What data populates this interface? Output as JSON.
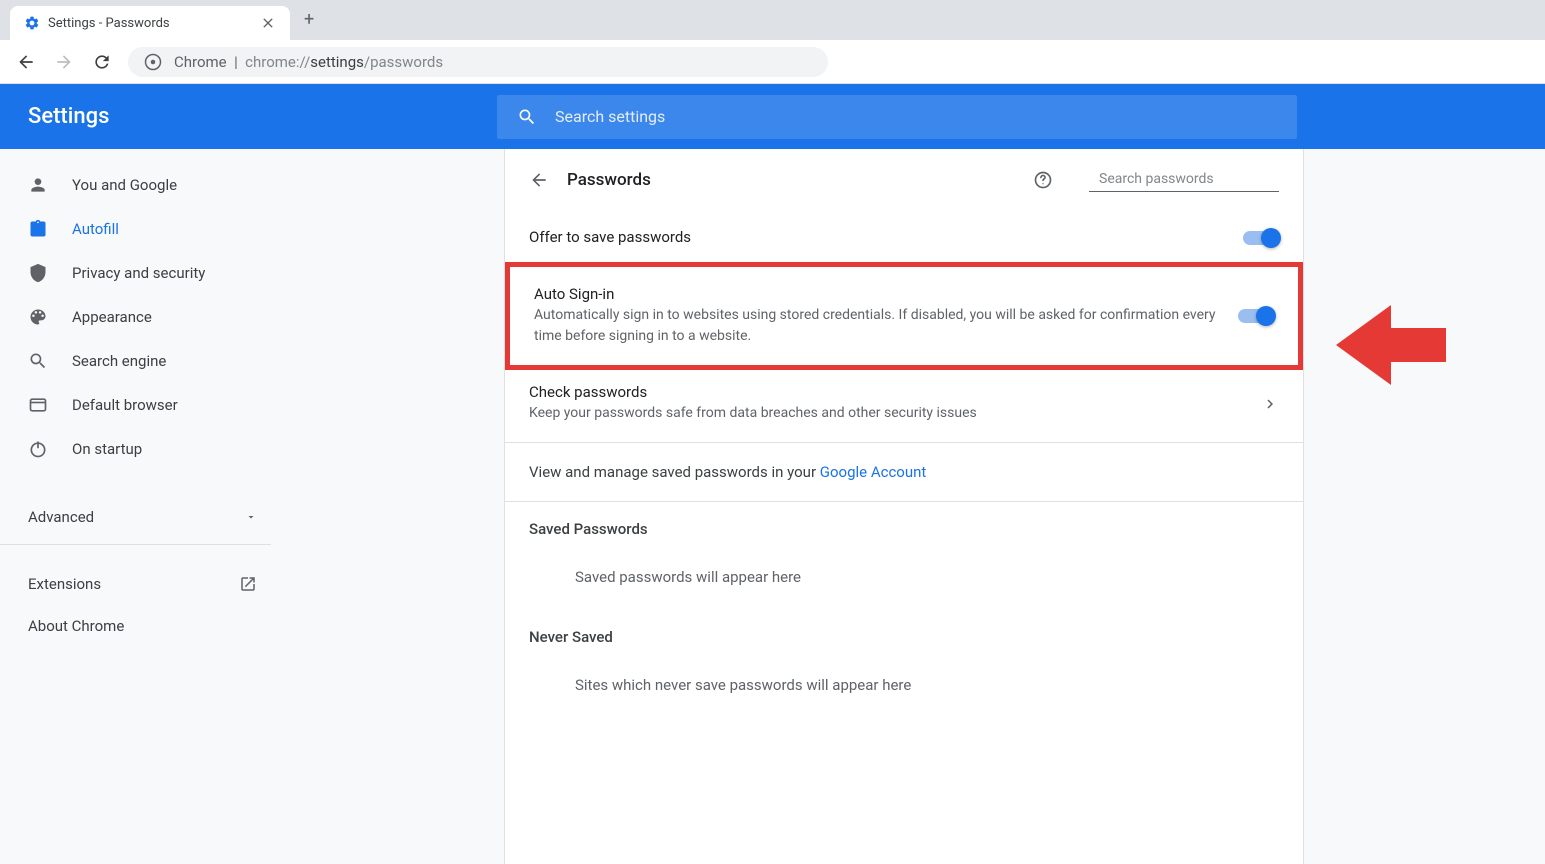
{
  "tab": {
    "title": "Settings - Passwords"
  },
  "address": {
    "origin": "Chrome",
    "url_pre": "chrome://",
    "url_mid": "settings",
    "url_post": "/passwords"
  },
  "header": {
    "title": "Settings",
    "search_placeholder": "Search settings"
  },
  "sidebar": {
    "items": [
      {
        "label": "You and Google"
      },
      {
        "label": "Autofill"
      },
      {
        "label": "Privacy and security"
      },
      {
        "label": "Appearance"
      },
      {
        "label": "Search engine"
      },
      {
        "label": "Default browser"
      },
      {
        "label": "On startup"
      }
    ],
    "advanced": "Advanced",
    "extensions": "Extensions",
    "about": "About Chrome"
  },
  "page": {
    "title": "Passwords",
    "search_placeholder": "Search passwords",
    "offer_save": "Offer to save passwords",
    "auto_signin": {
      "title": "Auto Sign-in",
      "desc": "Automatically sign in to websites using stored credentials. If disabled, you will be asked for confirmation every time before signing in to a website."
    },
    "check": {
      "title": "Check passwords",
      "desc": "Keep your passwords safe from data breaches and other security issues"
    },
    "view_manage_pre": "View and manage saved passwords in your ",
    "view_manage_link": "Google Account",
    "saved_hdr": "Saved Passwords",
    "saved_empty": "Saved passwords will appear here",
    "never_hdr": "Never Saved",
    "never_empty": "Sites which never save passwords will appear here"
  }
}
